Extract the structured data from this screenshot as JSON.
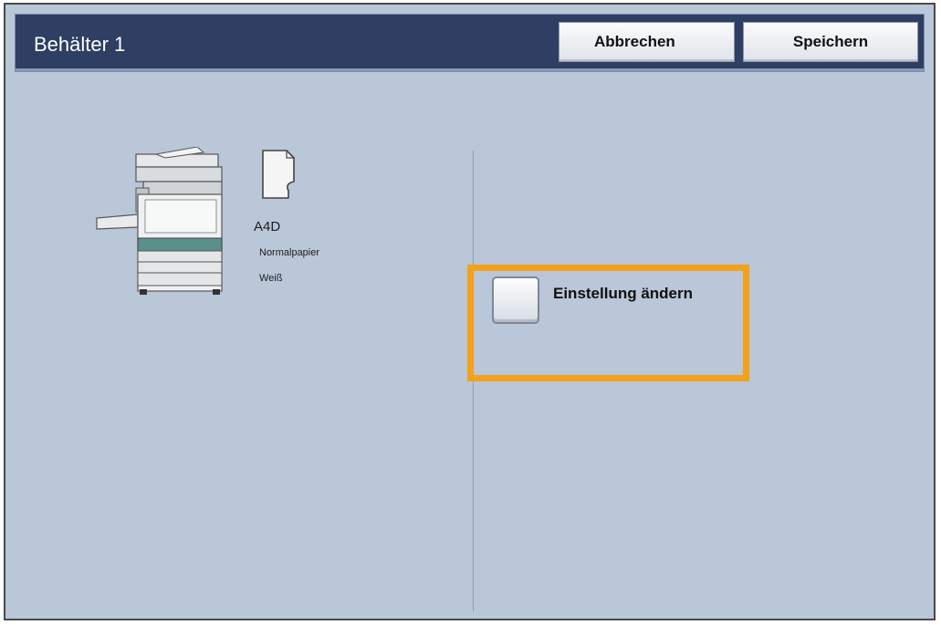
{
  "header": {
    "title": "Behälter 1",
    "cancel_label": "Abbrechen",
    "save_label": "Speichern"
  },
  "tray": {
    "paper_size": "A4D",
    "paper_type": "Normalpapier",
    "paper_color": "Weiß",
    "icons": {
      "device": "printer-icon",
      "paper": "paper-sheet-icon"
    }
  },
  "option": {
    "label": "Einstellung ändern",
    "checked": false
  },
  "colors": {
    "header_bg": "#2f3e63",
    "panel_bg": "#b9c7d8",
    "highlight": "#f4a11a",
    "accent_teal": "#5a8f8c"
  }
}
